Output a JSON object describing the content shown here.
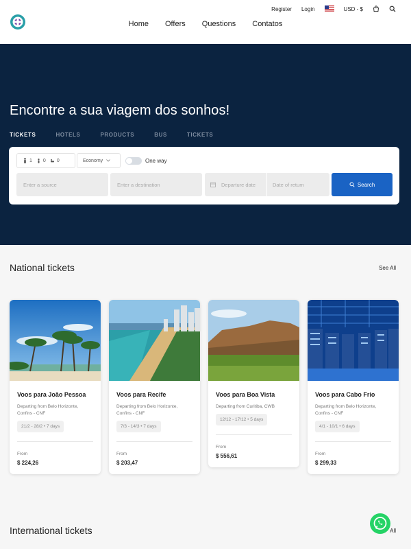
{
  "header": {
    "register": "Register",
    "login": "Login",
    "currency": "USD - $",
    "nav": [
      "Home",
      "Offers",
      "Questions",
      "Contatos"
    ]
  },
  "hero": {
    "title": "Encontre a sua viagem dos sonhos!",
    "tabs": [
      "TICKETS",
      "HOTELS",
      "PRODUCTS",
      "BUS",
      "TICKETS"
    ]
  },
  "search": {
    "adults": "1",
    "children": "0",
    "infants": "0",
    "cabin": "Economy",
    "one_way": "One way",
    "source_placeholder": "Enter a source",
    "dest_placeholder": "Enter a destination",
    "departure_placeholder": "Departure date",
    "return_placeholder": "Date of return",
    "search_label": "Search"
  },
  "national": {
    "title": "National tickets",
    "see_all": "See All",
    "cards": [
      {
        "title": "Voos para João Pessoa",
        "route": "Departing from Belo Horizonte, Confins - CNF",
        "dates": "21/2 - 28/2 • 7 days",
        "from": "From",
        "price": "$ 224,26"
      },
      {
        "title": "Voos para Recife",
        "route": "Departing from Belo Horizonte, Confins - CNF",
        "dates": "7/3 - 14/3 • 7 days",
        "from": "From",
        "price": "$ 203,47"
      },
      {
        "title": "Voos para Boa Vista",
        "route": "Departing from Curitiba, CWB",
        "dates": "12/12 - 17/12 • 5 days",
        "from": "From",
        "price": "$ 556,61"
      },
      {
        "title": "Voos para Cabo Frio",
        "route": "Departing from Belo Horizonte, Confins - CNF",
        "dates": "4/1 - 10/1 • 6 days",
        "from": "From",
        "price": "$ 299,33"
      }
    ]
  },
  "international": {
    "title": "International tickets",
    "see_all": "All"
  },
  "colors": {
    "hero_bg": "#0b2340",
    "accent": "#1a63c4",
    "whatsapp": "#25d366"
  }
}
